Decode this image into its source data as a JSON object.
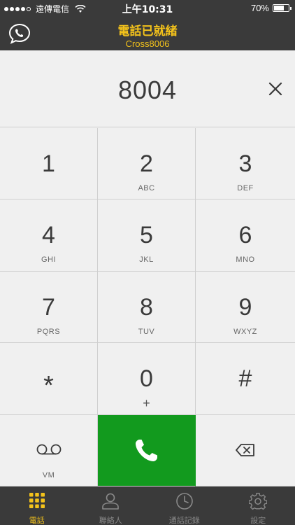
{
  "status_bar": {
    "carrier": "遠傳電信",
    "time": "上午10:31",
    "battery": "70%",
    "battery_level": 0.7
  },
  "header": {
    "title": "電話已就緒",
    "subtitle": "Cross8006",
    "icon": "phone-bubble-icon"
  },
  "dialer": {
    "number": "8004",
    "clear_icon": "close-icon"
  },
  "keypad": {
    "keys": [
      {
        "digit": "1",
        "letters": ""
      },
      {
        "digit": "2",
        "letters": "ABC"
      },
      {
        "digit": "3",
        "letters": "DEF"
      },
      {
        "digit": "4",
        "letters": "GHI"
      },
      {
        "digit": "5",
        "letters": "JKL"
      },
      {
        "digit": "6",
        "letters": "MNO"
      },
      {
        "digit": "7",
        "letters": "PQRS"
      },
      {
        "digit": "8",
        "letters": "TUV"
      },
      {
        "digit": "9",
        "letters": "WXYZ"
      },
      {
        "digit": "*",
        "letters": ""
      },
      {
        "digit": "0",
        "letters": "+"
      },
      {
        "digit": "#",
        "letters": ""
      }
    ],
    "vm_label": "VM",
    "call_color": "#129a1e"
  },
  "tabs": [
    {
      "label": "電話",
      "icon": "keypad-grid-icon",
      "active": true
    },
    {
      "label": "聯絡人",
      "icon": "contact-person-icon",
      "active": false
    },
    {
      "label": "通話記錄",
      "icon": "clock-icon",
      "active": false
    },
    {
      "label": "設定",
      "icon": "gear-icon",
      "active": false
    }
  ],
  "colors": {
    "accent": "#f3c21b",
    "bar_bg": "#3a3a3a",
    "keypad_bg": "#f0f0f0"
  }
}
